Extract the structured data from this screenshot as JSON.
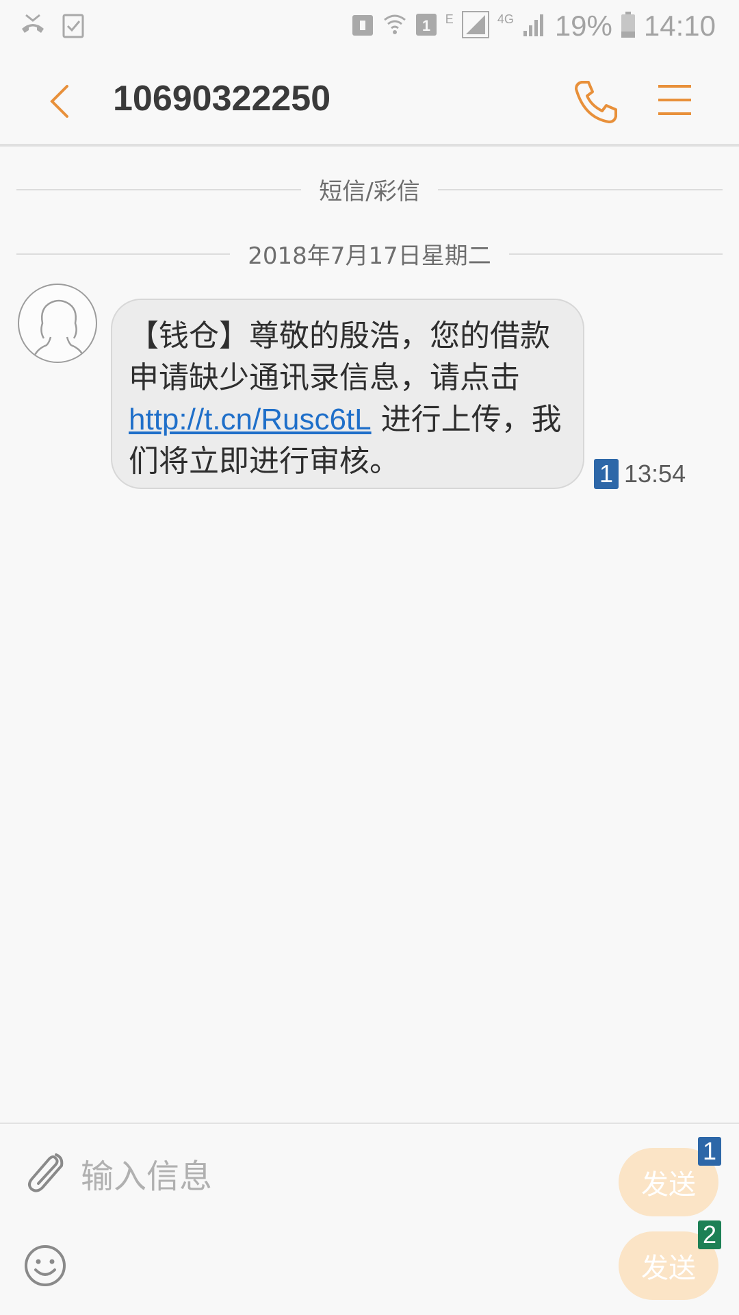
{
  "status_bar": {
    "sim_indicator": "1",
    "network_e": "E",
    "network_4g": "4G",
    "battery": "19%",
    "time": "14:10",
    "icons": [
      "missed-call-icon",
      "task-check-icon",
      "nfc-lock-icon",
      "wifi-icon",
      "sim-icon",
      "signal-icon",
      "signal-icon",
      "battery-icon"
    ]
  },
  "app_bar": {
    "title": "10690322250",
    "icons": [
      "back-arrow-icon",
      "phone-icon",
      "menu-icon"
    ],
    "accent_color": "#e8903a"
  },
  "conversation": {
    "type_label": "短信/彩信",
    "date_label": "2018年7月17日星期二",
    "messages": [
      {
        "text_before": "【钱仓】尊敬的殷浩，您的借款申请缺少通讯录信息，请点击 ",
        "link": "http://t.cn/Rusc6tL",
        "text_after": " 进行上传，我们将立即进行审核。",
        "sim": "1",
        "time": "13:54"
      }
    ]
  },
  "composer": {
    "placeholder": "输入信息",
    "send_label": "发送",
    "send_sims": [
      "1",
      "2"
    ],
    "icons": [
      "paperclip-icon",
      "emoji-icon"
    ]
  }
}
